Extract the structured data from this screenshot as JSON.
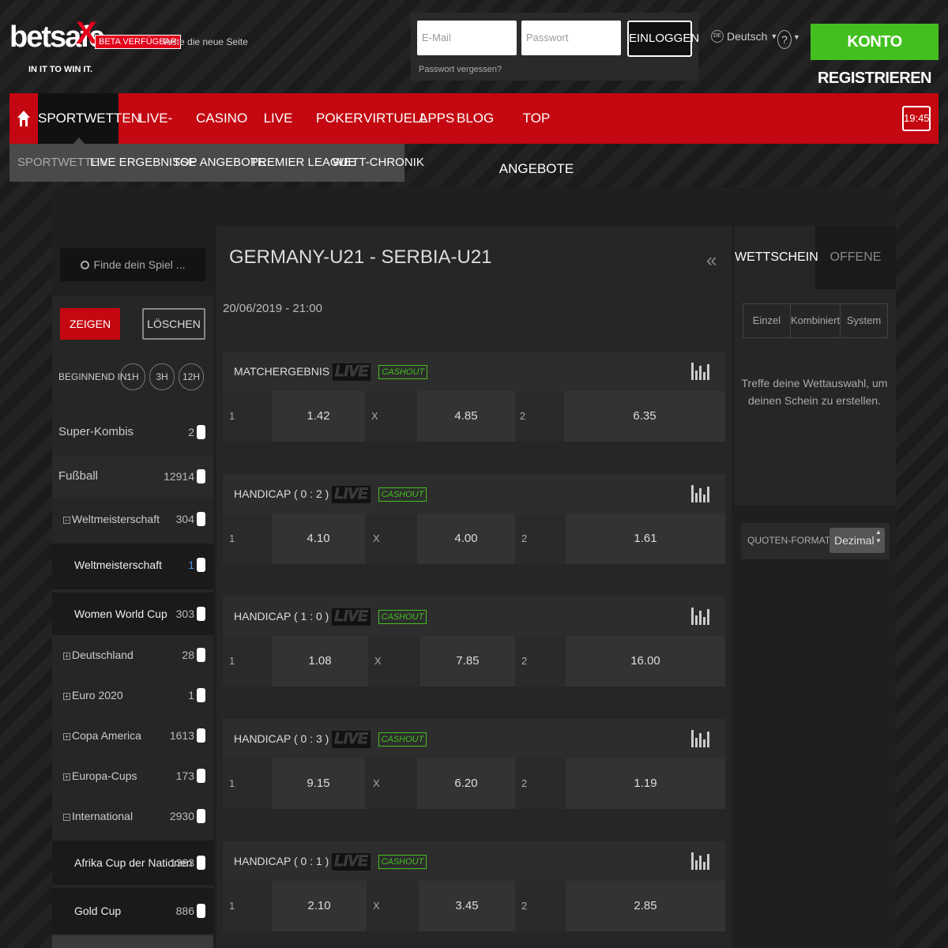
{
  "header": {
    "logo_text": "betsafe",
    "logo_mark": "X",
    "slogan": "IN IT TO WIN IT.",
    "beta_badge": "BETA VERFÜGBAR",
    "beta_text": "Teste die neue Seite",
    "email_placeholder": "E-Mail",
    "password_placeholder": "Passwort",
    "login_label": "EINLOGGEN",
    "forgot_label": "Passwort vergessen?",
    "language_code": "DE",
    "language_label": "Deutsch",
    "help_label": "?",
    "register_label": "KONTO REGISTRIEREN"
  },
  "nav": {
    "items": [
      "SPORTWETTEN",
      "LIVE-WETTEN",
      "CASINO",
      "LIVE CASINO",
      "POKER",
      "VIRTUELL",
      "APPS",
      "BLOG",
      "TOP ANGEBOTE"
    ],
    "active": "SPORTWETTEN",
    "time": "19:45"
  },
  "subnav": {
    "items": [
      "SPORTWETTEN",
      "LIVE ERGEBNISSE",
      "TOP ANGEBOTE",
      "PREMIER LEAGUE",
      "WETT-CHRONIK"
    ]
  },
  "sidebar": {
    "search_placeholder": "Finde dein Spiel ...",
    "show_label": "ZEIGEN",
    "clear_label": "LÖSCHEN",
    "starting_label": "BEGINNEND IN:",
    "time_filters": [
      "1H",
      "3H",
      "12H"
    ],
    "items": [
      {
        "label": "Super-Kombis",
        "count": "2"
      },
      {
        "label": "Fußball",
        "count": "12914"
      },
      {
        "label": "Weltmeisterschaft",
        "count": "304"
      },
      {
        "label": "Weltmeisterschaft",
        "count": "1"
      },
      {
        "label": "Women World Cup",
        "count": "303"
      },
      {
        "label": "Deutschland",
        "count": "28"
      },
      {
        "label": "Euro 2020",
        "count": "1"
      },
      {
        "label": "Copa America",
        "count": "1613"
      },
      {
        "label": "Europa-Cups",
        "count": "173"
      },
      {
        "label": "International",
        "count": "2930"
      },
      {
        "label": "Afrika Cup der Nationen",
        "count": "1363"
      },
      {
        "label": "Gold Cup",
        "count": "886"
      }
    ]
  },
  "match": {
    "title": "GERMANY-U21 - SERBIA-U21",
    "datetime": "20/06/2019 - 21:00",
    "live_label": "LIVE",
    "cashout_label": "CASHOUT",
    "markets": [
      {
        "name": "MATCHERGEBNIS",
        "labels": [
          "1",
          "X",
          "2"
        ],
        "odds": [
          "1.42",
          "4.85",
          "6.35"
        ]
      },
      {
        "name": "HANDICAP ( 0 : 2 )",
        "labels": [
          "1",
          "X",
          "2"
        ],
        "odds": [
          "4.10",
          "4.00",
          "1.61"
        ]
      },
      {
        "name": "HANDICAP ( 1 : 0 )",
        "labels": [
          "1",
          "X",
          "2"
        ],
        "odds": [
          "1.08",
          "7.85",
          "16.00"
        ]
      },
      {
        "name": "HANDICAP ( 0 : 3 )",
        "labels": [
          "1",
          "X",
          "2"
        ],
        "odds": [
          "9.15",
          "6.20",
          "1.19"
        ]
      },
      {
        "name": "HANDICAP ( 0 : 1 )",
        "labels": [
          "1",
          "X",
          "2"
        ],
        "odds": [
          "2.10",
          "3.45",
          "2.85"
        ]
      }
    ]
  },
  "betslip": {
    "tabs": [
      "WETTSCHEIN",
      "OFFENE WETTEN"
    ],
    "modes": [
      "Einzel",
      "Kombiniert",
      "System"
    ],
    "hint": "Treffe deine Wettauswahl, um deinen Schein zu erstellen.",
    "odds_format_label": "QUOTEN-FORMAT",
    "odds_format_value": "Dezimal"
  },
  "colors": {
    "brand_red": "#c40711",
    "logo_red": "#e3001b",
    "register_green": "#43c01f",
    "background": "#1b1b1b"
  }
}
